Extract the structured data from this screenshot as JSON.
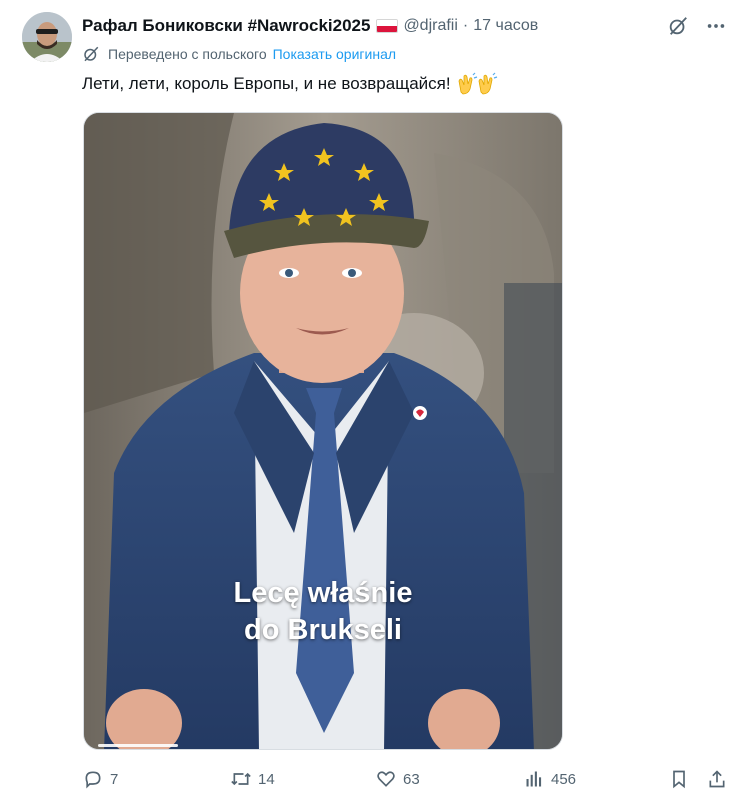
{
  "post": {
    "author_name": "Рафал Бониковски #Nawrocki2025",
    "flag_icon": "poland-flag-icon",
    "handle": "@djrafii",
    "separator": "·",
    "time": "17 часов",
    "translated_label": "Переведено с польского",
    "show_original": "Показать оригинал",
    "text": "Лети, лети, король Европы, и не возвращайся!",
    "emoji": "clapping-hands-emoji",
    "video_caption_line1": "Lecę właśnie",
    "video_caption_line2": "do Brukseli"
  },
  "stats": {
    "replies": "7",
    "reposts": "14",
    "likes": "63",
    "views": "456"
  },
  "colors": {
    "accent": "#1d9bf0",
    "text_primary": "#0f1419",
    "text_secondary": "#536471",
    "flag_red": "#dc143c"
  }
}
